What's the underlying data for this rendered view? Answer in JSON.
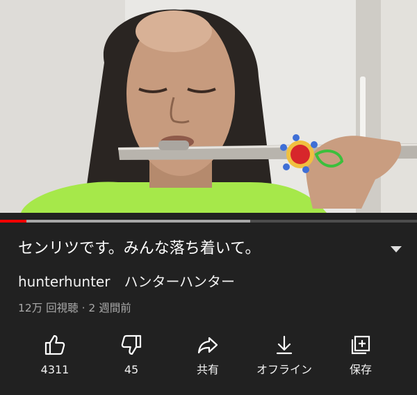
{
  "video": {
    "progress": 0.063,
    "buffered": 0.6
  },
  "title": "センリツです。みんな落ち着いて。",
  "channel": "hunterhunter　ハンターハンター",
  "meta": "12万 回視聴 · 2 週間前",
  "actions": [
    {
      "icon": "thumbs-up-icon",
      "label": "4311"
    },
    {
      "icon": "thumbs-down-icon",
      "label": "45"
    },
    {
      "icon": "share-icon",
      "label": "共有"
    },
    {
      "icon": "download-icon",
      "label": "オフライン"
    },
    {
      "icon": "save-playlist-icon",
      "label": "保存"
    }
  ],
  "colors": {
    "background": "#212121",
    "progress_played": "#ff0000",
    "shirt": "#a6e84a"
  }
}
